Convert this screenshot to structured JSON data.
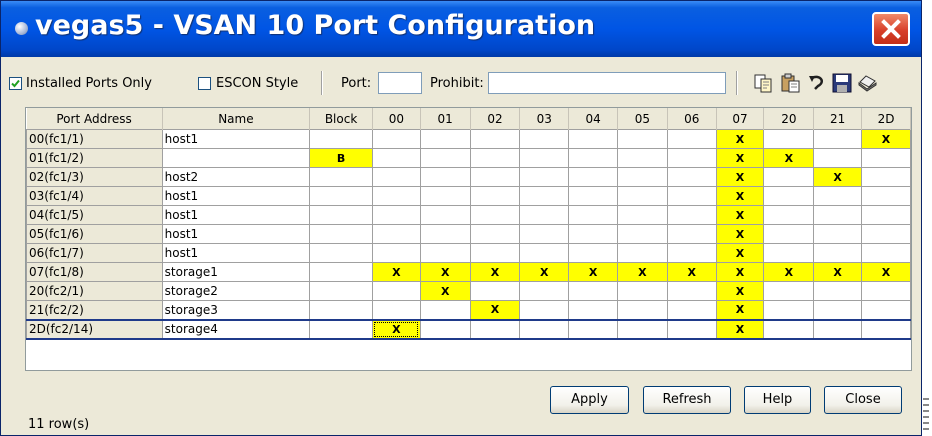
{
  "window": {
    "title": "vegas5 - VSAN 10 Port Configuration"
  },
  "toolbar": {
    "installed_ports_only": {
      "label": "Installed Ports Only",
      "checked": true
    },
    "escon_style": {
      "label": "ESCON Style",
      "checked": false
    },
    "port_label": "Port:",
    "port_value": "",
    "prohibit_label": "Prohibit:",
    "prohibit_value": "",
    "icons": [
      "copy-icon",
      "paste-icon",
      "undo-icon",
      "save-icon",
      "print-icon"
    ]
  },
  "table": {
    "headers": [
      "Port Address",
      "Name",
      "Block",
      "00",
      "01",
      "02",
      "03",
      "04",
      "05",
      "06",
      "07",
      "20",
      "21",
      "2D"
    ],
    "rows": [
      [
        "00(fc1/1)",
        "host1",
        "",
        "",
        "",
        "",
        "",
        "",
        "",
        "",
        "X",
        "",
        "",
        "X"
      ],
      [
        "01(fc1/2)",
        "",
        "B",
        "",
        "",
        "",
        "",
        "",
        "",
        "",
        "X",
        "X",
        "",
        ""
      ],
      [
        "02(fc1/3)",
        "host2",
        "",
        "",
        "",
        "",
        "",
        "",
        "",
        "",
        "X",
        "",
        "X",
        ""
      ],
      [
        "03(fc1/4)",
        "host1",
        "",
        "",
        "",
        "",
        "",
        "",
        "",
        "",
        "X",
        "",
        "",
        ""
      ],
      [
        "04(fc1/5)",
        "host1",
        "",
        "",
        "",
        "",
        "",
        "",
        "",
        "",
        "X",
        "",
        "",
        ""
      ],
      [
        "05(fc1/6)",
        "host1",
        "",
        "",
        "",
        "",
        "",
        "",
        "",
        "",
        "X",
        "",
        "",
        ""
      ],
      [
        "06(fc1/7)",
        "host1",
        "",
        "",
        "",
        "",
        "",
        "",
        "",
        "",
        "X",
        "",
        "",
        ""
      ],
      [
        "07(fc1/8)",
        "storage1",
        "",
        "X",
        "X",
        "X",
        "X",
        "X",
        "X",
        "X",
        "X",
        "X",
        "X",
        "X"
      ],
      [
        "20(fc2/1)",
        "storage2",
        "",
        "",
        "X",
        "",
        "",
        "",
        "",
        "",
        "X",
        "",
        "",
        ""
      ],
      [
        "21(fc2/2)",
        "storage3",
        "",
        "",
        "",
        "X",
        "",
        "",
        "",
        "",
        "X",
        "",
        "",
        ""
      ],
      [
        "2D(fc2/14)",
        "storage4",
        "",
        "X",
        "",
        "",
        "",
        "",
        "",
        "",
        "X",
        "",
        "",
        ""
      ]
    ],
    "selected_row": 10
  },
  "buttons": {
    "apply": "Apply",
    "refresh": "Refresh",
    "help": "Help",
    "close": "Close"
  },
  "status": {
    "row_count": "11 row(s)"
  },
  "colors": {
    "title_bar": "#0055e5",
    "highlight": "#ffff00",
    "window_bg": "#ece9d8",
    "close_button": "#d8402a"
  }
}
